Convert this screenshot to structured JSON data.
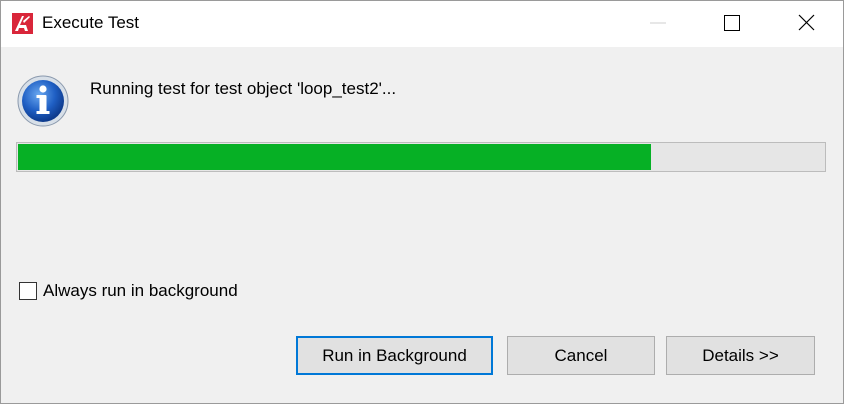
{
  "window": {
    "title": "Execute Test",
    "controls": [
      "minimize-icon",
      "maximize-icon",
      "close-icon"
    ]
  },
  "main": {
    "icon": "info-icon",
    "message": "Running test for test object 'loop_test2'...",
    "progress": {
      "percent": 78.5,
      "color": "#06b025"
    }
  },
  "options": {
    "always_background_label": "Always run in background",
    "always_background_checked": false
  },
  "buttons": {
    "run_in_background": "Run in Background",
    "cancel": "Cancel",
    "details": "Details >>"
  },
  "colors": {
    "accent_focus": "#0078d7",
    "progress_green": "#06b025",
    "app_icon_red": "#d9263a"
  }
}
